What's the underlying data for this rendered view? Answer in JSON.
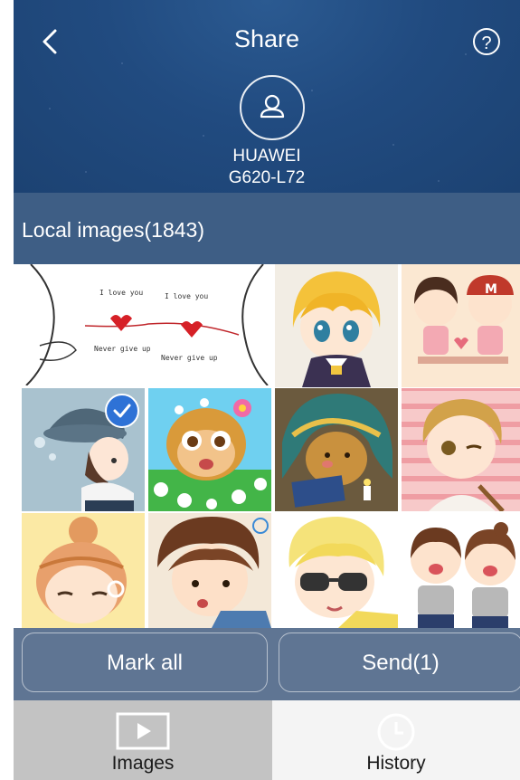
{
  "header": {
    "title": "Share",
    "device_line1": "HUAWEI",
    "device_line2": "G620-L72",
    "icons": {
      "back": "chevron-left-icon",
      "help": "help-circle-icon",
      "avatar": "user-icon"
    },
    "help_glyph": "?"
  },
  "section": {
    "title": "Local images(1843)"
  },
  "grid": {
    "images": [
      {
        "name": "love-line-couple",
        "text_top": "I love you",
        "text_bottom": "Never give up",
        "selected": false
      },
      {
        "name": "blonde-anime-boy",
        "selected": false
      },
      {
        "name": "chibi-couple-pink",
        "badge_letter": "M",
        "selected": false
      },
      {
        "name": "girl-blue-hat",
        "selected": true
      },
      {
        "name": "monkey-flowers",
        "selected": false
      },
      {
        "name": "monkey-reading-blanket",
        "selected": false
      },
      {
        "name": "boy-blonde-winking",
        "selected": false
      },
      {
        "name": "girl-bun-hair",
        "selected": false
      },
      {
        "name": "boy-brown-hair",
        "selected": false
      },
      {
        "name": "boy-sunglasses",
        "selected": false
      },
      {
        "name": "happy-couple-hug",
        "selected": false
      }
    ]
  },
  "actions": {
    "mark_all_label": "Mark all",
    "send_label": "Send(1)"
  },
  "tabs": [
    {
      "label": "Images",
      "icon": "image-play-icon",
      "active": true
    },
    {
      "label": "History",
      "icon": "clock-icon",
      "active": false
    }
  ],
  "colors": {
    "header_bg": "#214b80",
    "section_bg": "#3e5e85",
    "action_bg": "#5f7593",
    "selection_blue": "#2e72d6",
    "tab_active_bg": "#c3c3c3",
    "tab_inactive_bg": "#f4f4f4"
  }
}
